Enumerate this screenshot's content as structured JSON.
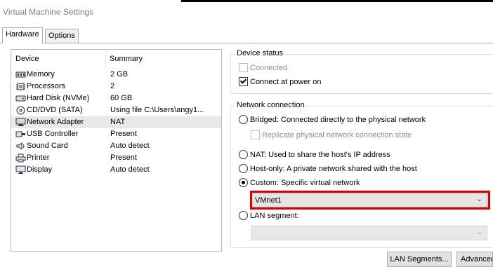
{
  "window": {
    "title": "Virtual Machine Settings"
  },
  "tabs": [
    {
      "label": "Hardware",
      "active": true
    },
    {
      "label": "Options",
      "active": false
    }
  ],
  "device_list": {
    "headers": {
      "device": "Device",
      "summary": "Summary"
    },
    "rows": [
      {
        "icon": "memory-icon",
        "device": "Memory",
        "summary": "2 GB"
      },
      {
        "icon": "processor-icon",
        "device": "Processors",
        "summary": "2"
      },
      {
        "icon": "hard-disk-icon",
        "device": "Hard Disk (NVMe)",
        "summary": "60 GB"
      },
      {
        "icon": "cd-dvd-icon",
        "device": "CD/DVD (SATA)",
        "summary": "Using file C:\\Users\\angy1..."
      },
      {
        "icon": "network-adapter-icon",
        "device": "Network Adapter",
        "summary": "NAT",
        "selected": true
      },
      {
        "icon": "usb-icon",
        "device": "USB Controller",
        "summary": "Present"
      },
      {
        "icon": "sound-card-icon",
        "device": "Sound Card",
        "summary": "Auto detect"
      },
      {
        "icon": "printer-icon",
        "device": "Printer",
        "summary": "Present"
      },
      {
        "icon": "display-icon",
        "device": "Display",
        "summary": "Auto detect"
      }
    ]
  },
  "device_status": {
    "label": "Device status",
    "connected": {
      "label": "Connected",
      "checked": false,
      "disabled": true
    },
    "connect_at_power_on": {
      "label": "Connect at power on",
      "checked": true
    }
  },
  "network_connection": {
    "label": "Network connection",
    "bridged": {
      "label": "Bridged: Connected directly to the physical network",
      "selected": false
    },
    "replicate": {
      "label": "Replicate physical network connection state",
      "checked": false,
      "disabled": true
    },
    "nat": {
      "label": "NAT: Used to share the host's IP address",
      "selected": false
    },
    "host_only": {
      "label": "Host-only: A private network shared with the host",
      "selected": false
    },
    "custom": {
      "label": "Custom: Specific virtual network",
      "selected": true
    },
    "custom_select": {
      "value": "VMnet1"
    },
    "lan_segment": {
      "label": "LAN segment:",
      "selected": false
    },
    "lan_segment_select": {
      "value": ""
    }
  },
  "buttons": {
    "lan_segments": "LAN Segments...",
    "advanced": "Advanced..."
  },
  "colors": {
    "highlight": "#e00000",
    "selected_row": "#e8e8e8"
  }
}
